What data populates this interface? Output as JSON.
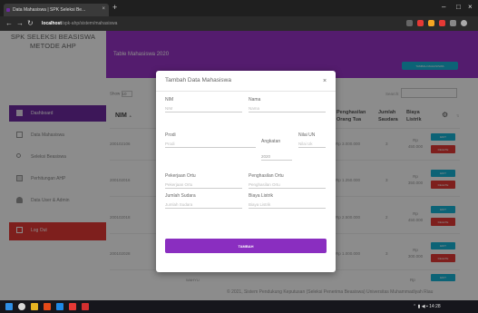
{
  "browser": {
    "tab_title": "Data Mahasiswa | SPK Seleksi Be...",
    "tab_close": "×",
    "new_tab": "+",
    "url_host": "localhost",
    "url_path": "/spk-ahp/sistem/mahasiswa",
    "back": "←",
    "forward": "→",
    "reload": "↻",
    "minimize": "–",
    "maximize": "□",
    "close": "×"
  },
  "sidebar": {
    "brand_line1": "SPK SELEKSI BEASISWA",
    "brand_line2": "METODE AHP",
    "items": [
      {
        "label": "Dashboard",
        "icon": "dashboard-icon"
      },
      {
        "label": "Data Mahasiswa",
        "icon": "document-icon"
      },
      {
        "label": "Seleksi Beasiswa",
        "icon": "search-icon"
      },
      {
        "label": "Perhitungan AHP",
        "icon": "calculator-icon"
      },
      {
        "label": "Data User & Admin",
        "icon": "user-icon"
      },
      {
        "label": "Log Out",
        "icon": "logout-icon"
      }
    ]
  },
  "page": {
    "title": "Table Mahasiswa 2020",
    "add_button": "TAMBAH MAHASISWA",
    "show_label": "Show",
    "show_value": "10",
    "search_label": "Search:",
    "columns": {
      "nim": "NIM",
      "penghasilan": "Penghasilan Orang Tua",
      "jumlah": "Jumlah Saudara",
      "biaya": "Biaya Listrik"
    },
    "rows": [
      {
        "nim": "200102106",
        "penghasilan": "Rp 3.000.000",
        "jumlah": "3",
        "biaya": "Rp 450.000"
      },
      {
        "nim": "200102016",
        "penghasilan": "Rp 1.250.000",
        "jumlah": "3",
        "biaya": "Rp 350.000"
      },
      {
        "nim": "200102018",
        "penghasilan": "Rp 2.500.000",
        "jumlah": "2",
        "biaya": "Rp 450.000"
      },
      {
        "nim": "200102028",
        "penghasilan": "Rp 1.000.000",
        "jumlah": "3",
        "biaya": "Rp 300.000"
      }
    ],
    "edit_label": "EDIT",
    "delete_label": "DELETE",
    "next_label": "WAHYU",
    "footer": "© 2021, Sistem Pendukung Keputusan (Seleksi Penerima Beasiswa) Universitas Muhammadiyah Riau"
  },
  "modal": {
    "title": "Tambah Data Mahasiswa",
    "close": "×",
    "fields": {
      "nim": {
        "label": "NIM",
        "placeholder": "NIM"
      },
      "nama": {
        "label": "Nama",
        "placeholder": "Nama"
      },
      "prodi": {
        "label": "Prodi",
        "placeholder": "Prodi"
      },
      "angkatan": {
        "label": "Angkatan",
        "value": "2020"
      },
      "nilai_un": {
        "label": "Nilai UN",
        "placeholder": "Nilai Uk"
      },
      "pekerjaan": {
        "label": "Pekerjaan Ortu",
        "placeholder": "Pekerjaan Ortu"
      },
      "penghasilan": {
        "label": "Penghasilan Ortu",
        "placeholder": "Penghasilan Ortu"
      },
      "jumlah_saudara": {
        "label": "Jumlah Sudara",
        "placeholder": "Jumlah Sudara"
      },
      "biaya_listrik": {
        "label": "Biaya Listrik",
        "placeholder": "Biaya Listrik"
      }
    },
    "submit": "TAMBAH"
  },
  "taskbar": {
    "clock": "14:28"
  }
}
